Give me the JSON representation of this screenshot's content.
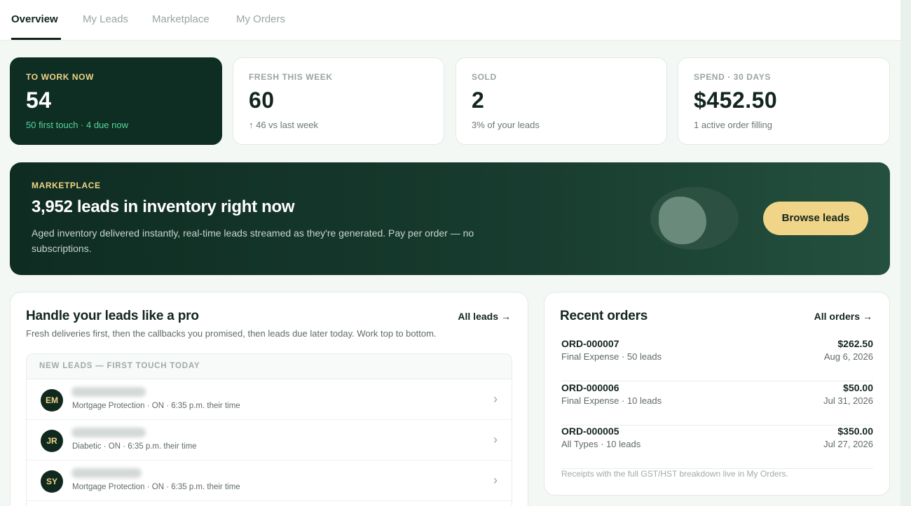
{
  "tabs": [
    {
      "label": "Overview",
      "active": true
    },
    {
      "label": "My Leads"
    },
    {
      "label": "Marketplace"
    },
    {
      "label": "My Orders"
    }
  ],
  "stats": [
    {
      "label": "TO WORK NOW",
      "value": "54",
      "sub": "50 first touch · 4 due now"
    },
    {
      "label": "FRESH THIS WEEK",
      "value": "60",
      "sub": "↑ 46 vs last week"
    },
    {
      "label": "SOLD",
      "value": "2",
      "sub": "3% of your leads"
    },
    {
      "label": "SPEND · 30 DAYS",
      "value": "$452.50",
      "sub": "1 active order filling"
    }
  ],
  "marketplace": {
    "label": "MARKETPLACE",
    "title": "3,952 leads in inventory right now",
    "description": "Aged inventory delivered instantly, real-time leads streamed as they're generated. Pay per order — no subscriptions.",
    "button": "Browse leads"
  },
  "leads_card": {
    "title": "Handle your leads like a pro",
    "link": "All leads",
    "description": "Fresh deliveries first, then the callbacks you promised, then leads due later today. Work top to bottom.",
    "section_header": "NEW LEADS — FIRST TOUCH TODAY",
    "rows": [
      {
        "initials": "EM",
        "meta": "Mortgage Protection · ON · 6:35 p.m. their time"
      },
      {
        "initials": "JR",
        "meta": "Diabetic · ON · 6:35 p.m. their time"
      },
      {
        "initials": "SY",
        "meta": "Mortgage Protection · ON · 6:35 p.m. their time"
      }
    ]
  },
  "orders_card": {
    "title": "Recent orders",
    "link": "All orders",
    "orders": [
      {
        "id": "ORD-000007",
        "meta": "Final Expense · 50 leads",
        "amount": "$262.50",
        "date": "Aug 6, 2026"
      },
      {
        "id": "ORD-000006",
        "meta": "Final Expense · 10 leads",
        "amount": "$50.00",
        "date": "Jul 31, 2026"
      },
      {
        "id": "ORD-000005",
        "meta": "All Types · 10 leads",
        "amount": "$350.00",
        "date": "Jul 27, 2026"
      }
    ],
    "footer": "Receipts with the full GST/HST breakdown live in My Orders."
  },
  "icons": {
    "arrow": "arrow-right-icon",
    "chevron": "chevron-right-icon"
  },
  "colors": {
    "dark_green": "#0e2d23",
    "accent_gold": "#f0d487",
    "accent_mint": "#57d69a"
  }
}
